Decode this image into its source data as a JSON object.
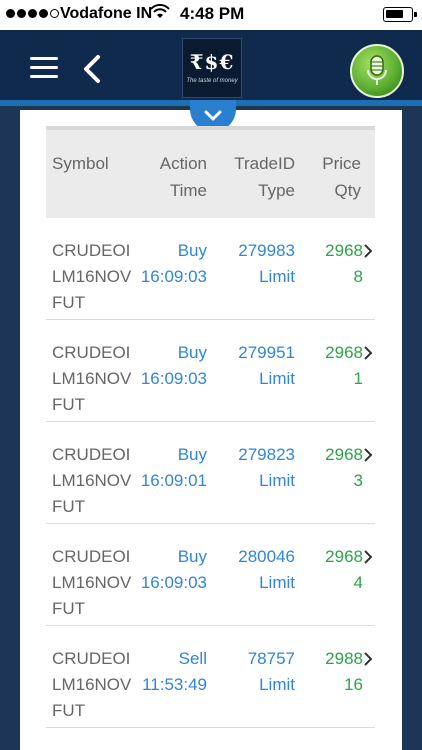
{
  "status_bar": {
    "carrier": "Vodafone IN",
    "time": "4:48 PM",
    "battery_level": 0.72
  },
  "header": {
    "logo_text": "₹$€",
    "logo_tagline": "The taste of money"
  },
  "table": {
    "columns": [
      {
        "line1": "Symbol",
        "line2": ""
      },
      {
        "line1": "Action",
        "line2": "Time"
      },
      {
        "line1": "TradeID",
        "line2": "Type"
      },
      {
        "line1": "Price",
        "line2": "Qty"
      }
    ],
    "rows": [
      {
        "symbol": "CRUDEOILM16NOVFUT",
        "action": "Buy",
        "time": "16:09:03",
        "trade_id": "279983",
        "type": "Limit",
        "price": "2968",
        "qty": "8"
      },
      {
        "symbol": "CRUDEOILM16NOVFUT",
        "action": "Buy",
        "time": "16:09:03",
        "trade_id": "279951",
        "type": "Limit",
        "price": "2968",
        "qty": "1"
      },
      {
        "symbol": "CRUDEOILM16NOVFUT",
        "action": "Buy",
        "time": "16:09:01",
        "trade_id": "279823",
        "type": "Limit",
        "price": "2968",
        "qty": "3"
      },
      {
        "symbol": "CRUDEOILM16NOVFUT",
        "action": "Buy",
        "time": "16:09:03",
        "trade_id": "280046",
        "type": "Limit",
        "price": "2968",
        "qty": "4"
      },
      {
        "symbol": "CRUDEOILM16NOVFUT",
        "action": "Sell",
        "time": "11:53:49",
        "trade_id": "78757",
        "type": "Limit",
        "price": "2988",
        "qty": "16"
      }
    ]
  },
  "colors": {
    "header_bg": "#0f2a4d",
    "accent_blue": "#2e86de",
    "price_green": "#2fa24a",
    "label_gray": "#666666"
  }
}
